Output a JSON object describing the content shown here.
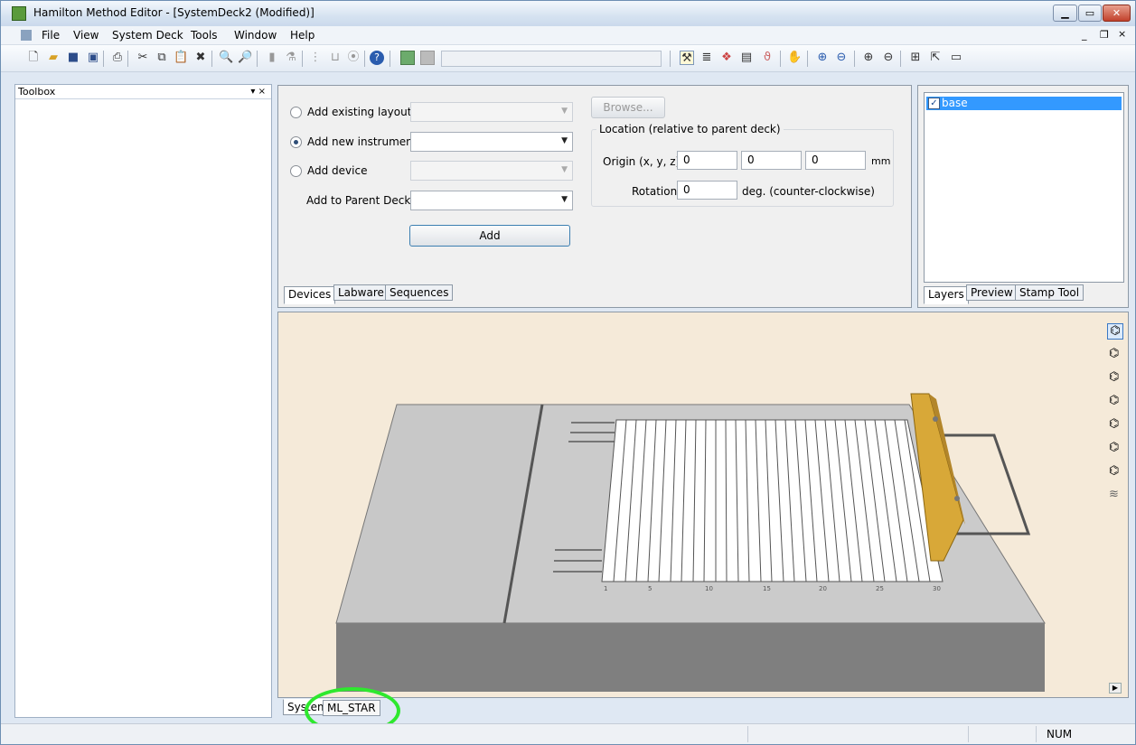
{
  "window": {
    "title": "Hamilton Method Editor - [SystemDeck2 (Modified)]"
  },
  "menu": {
    "items": [
      "File",
      "View",
      "System Deck",
      "Tools",
      "Window",
      "Help"
    ]
  },
  "toolbox": {
    "title": "Toolbox",
    "pin": "▾ ×"
  },
  "devices": {
    "add_existing_layout": "Add existing layout",
    "add_new_instrument": "Add new instrument",
    "add_device": "Add device",
    "add_to_parent_deck": "Add to Parent Deck",
    "browse": "Browse...",
    "add": "Add",
    "location_group": "Location (relative to parent deck)",
    "origin_label": "Origin (x, y, z):",
    "origin_x": "0",
    "origin_y": "0",
    "origin_z": "0",
    "origin_unit": "mm",
    "rotation_label": "Rotation:",
    "rotation_value": "0",
    "rotation_unit": "deg. (counter-clockwise)",
    "selected_option": "Add new instrument"
  },
  "devpanel_tabs": [
    "Devices",
    "Labware",
    "Sequences"
  ],
  "layers": {
    "item_label": "base",
    "item_checked": true,
    "tabs": [
      "Layers",
      "Preview",
      "Stamp Tool"
    ]
  },
  "deck": {
    "ruler_labels": [
      "1",
      "5",
      "10",
      "15",
      "20",
      "25",
      "30"
    ]
  },
  "bottom_tabs": [
    "System",
    "ML_STAR"
  ],
  "highlight_color": "#2ee82e",
  "status": {
    "num": "NUM"
  }
}
